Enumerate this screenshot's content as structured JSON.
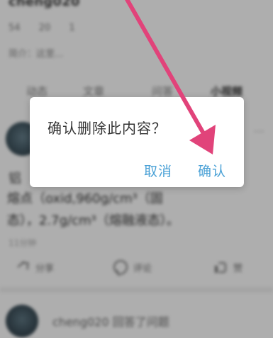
{
  "profile": {
    "username": "cheng020",
    "stats": [
      "54",
      "20",
      "1"
    ],
    "bio": "简介：这里..."
  },
  "tabs": [
    {
      "label": "动态"
    },
    {
      "label": "文章"
    },
    {
      "label": "问答"
    },
    {
      "label": "小视频"
    }
  ],
  "post": {
    "more_icon": "more-horizontal-icon",
    "title": "铝",
    "line1": "熔点（oxid,960g/cm³（固",
    "line2": "态），2.7g/cm³（熔融液态）。",
    "meta": "11分钟"
  },
  "actions": {
    "share": "分享",
    "comment": "评论",
    "like": "赞"
  },
  "bottom_post": {
    "text": "cheng020 回答了问题"
  },
  "dialog": {
    "message": "确认删除此内容？",
    "cancel": "取消",
    "confirm": "确认"
  },
  "colors": {
    "accent": "#4aa1d6",
    "arrow": "#e1437a"
  }
}
